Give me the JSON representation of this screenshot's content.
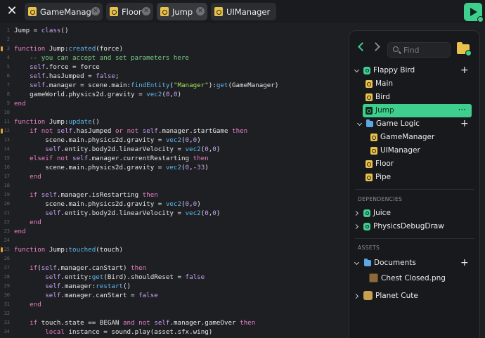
{
  "tabs": [
    {
      "label": "GameManager",
      "active": false
    },
    {
      "label": "Floor",
      "active": false
    },
    {
      "label": "Jump",
      "active": true
    },
    {
      "label": "UIManager",
      "active": false
    }
  ],
  "icons": {
    "close": "close-icon",
    "play": "play-icon",
    "file": "lua-file-icon"
  },
  "editor": {
    "lines": [
      {
        "n": "1",
        "code": "Jump = class()"
      },
      {
        "n": "2",
        "code": ""
      },
      {
        "n": "3",
        "code": "function Jump:created(force)"
      },
      {
        "n": "4",
        "code": "    -- you can accept and set parameters here"
      },
      {
        "n": "5",
        "code": "    self.force = force"
      },
      {
        "n": "6",
        "code": "    self.hasJumped = false;"
      },
      {
        "n": "7",
        "code": "    self.manager = scene.main:findEntity(\"Manager\"):get(GameManager)"
      },
      {
        "n": "8",
        "code": "    gameWorld.physics2d.gravity = vec2(0,0)"
      },
      {
        "n": "9",
        "code": "end"
      },
      {
        "n": "10",
        "code": ""
      },
      {
        "n": "11",
        "code": "function Jump:update()"
      },
      {
        "n": "12",
        "code": "    if not self.hasJumped or not self.manager.startGame then"
      },
      {
        "n": "13",
        "code": "        scene.main.physics2d.gravity = vec2(0,0)"
      },
      {
        "n": "14",
        "code": "        self.entity.body2d.linearVelocity = vec2(0,0)"
      },
      {
        "n": "15",
        "code": "    elseif not self.manager.currentRestarting then"
      },
      {
        "n": "16",
        "code": "        scene.main.physics2d.gravity = vec2(0,-33)"
      },
      {
        "n": "17",
        "code": "    end"
      },
      {
        "n": "18",
        "code": ""
      },
      {
        "n": "19",
        "code": "    if self.manager.isRestarting then"
      },
      {
        "n": "20",
        "code": "        scene.main.physics2d.gravity = vec2(0,0)"
      },
      {
        "n": "21",
        "code": "        self.entity.body2d.linearVelocity = vec2(0,0)"
      },
      {
        "n": "22",
        "code": "    end"
      },
      {
        "n": "23",
        "code": "end"
      },
      {
        "n": "24",
        "code": ""
      },
      {
        "n": "25",
        "code": "function Jump:touched(touch)"
      },
      {
        "n": "26",
        "code": ""
      },
      {
        "n": "27",
        "code": "    if(self.manager.canStart) then"
      },
      {
        "n": "28",
        "code": "        self.entity:get(Bird).shouldReset = false"
      },
      {
        "n": "29",
        "code": "        self.manager:restart()"
      },
      {
        "n": "30",
        "code": "        self.manager.canStart = false"
      },
      {
        "n": "31",
        "code": "    end"
      },
      {
        "n": "32",
        "code": ""
      },
      {
        "n": "33",
        "code": "    if touch.state == BEGAN and not self.manager.gameOver then"
      },
      {
        "n": "34",
        "code": "        local instance = sound.play(asset.sfx.wing)"
      }
    ]
  },
  "panel": {
    "search_placeholder": "Find",
    "project": {
      "label": "Flappy Bird",
      "items": [
        "Main",
        "Bird",
        "Jump"
      ]
    },
    "folder": {
      "label": "Game Logic",
      "items": [
        "GameManager",
        "UIManager"
      ]
    },
    "root_files": [
      "Floor",
      "Pipe"
    ],
    "dependencies_header": "DEPENDENCIES",
    "dependencies": [
      "Juice",
      "PhysicsDebugDraw"
    ],
    "assets_header": "ASSETS",
    "assets": {
      "documents": "Documents",
      "chest": "Chest Closed.png",
      "cute": "Planet Cute"
    },
    "selected_more": "···"
  },
  "colors": {
    "accent": "#3ecf8e",
    "file": "#e8c24a",
    "folder": "#5aa9e6"
  }
}
